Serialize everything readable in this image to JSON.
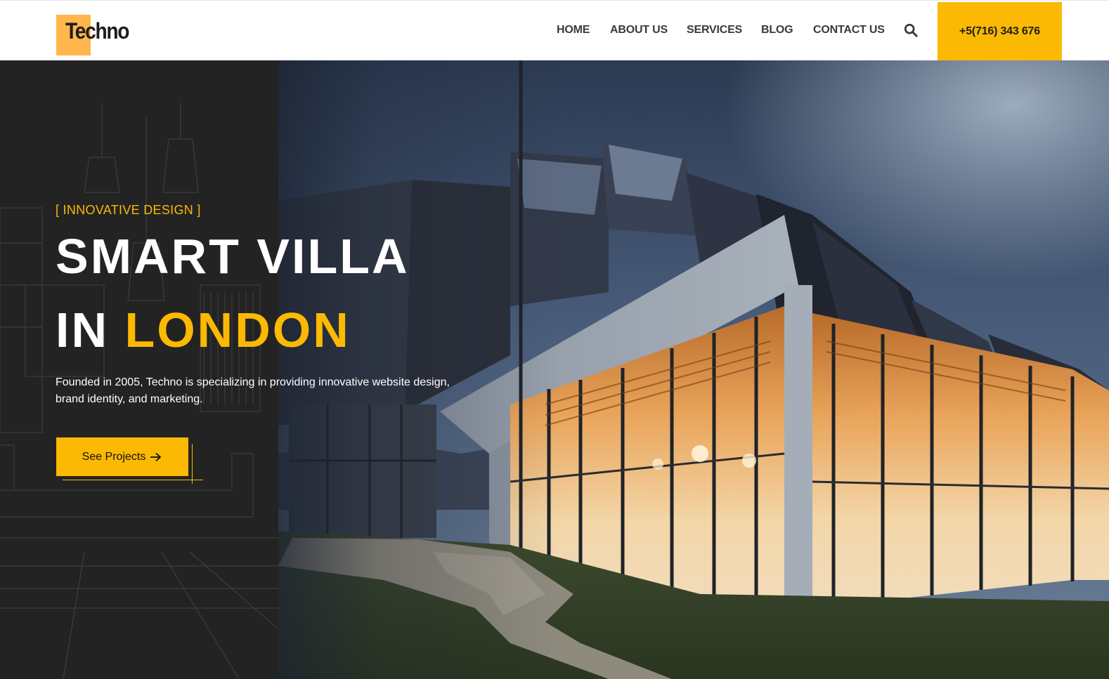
{
  "colors": {
    "accent": "#fbb903",
    "logo_square": "#ffb74d",
    "dark_panel": "#232323",
    "header_bg": "#ffffff",
    "nav_text": "#3a3a3a"
  },
  "header": {
    "logo_text": "Techno",
    "nav": [
      {
        "label": "HOME"
      },
      {
        "label": "ABOUT US"
      },
      {
        "label": "SERVICES"
      },
      {
        "label": "BLOG"
      },
      {
        "label": "CONTACT US"
      }
    ],
    "search_icon": "search-icon",
    "phone": "+5(716) 343 676"
  },
  "hero": {
    "kicker": "[ INNOVATIVE DESIGN ]",
    "title_line1": "SMART VILLA",
    "title_line2_prefix": "IN ",
    "title_line2_highlight": "LONDON",
    "description": "Founded in 2005, Techno is specializing in providing innovative website design, brand identity, and marketing.",
    "cta_label": "See Projects",
    "cta_icon": "arrow-right-icon"
  }
}
